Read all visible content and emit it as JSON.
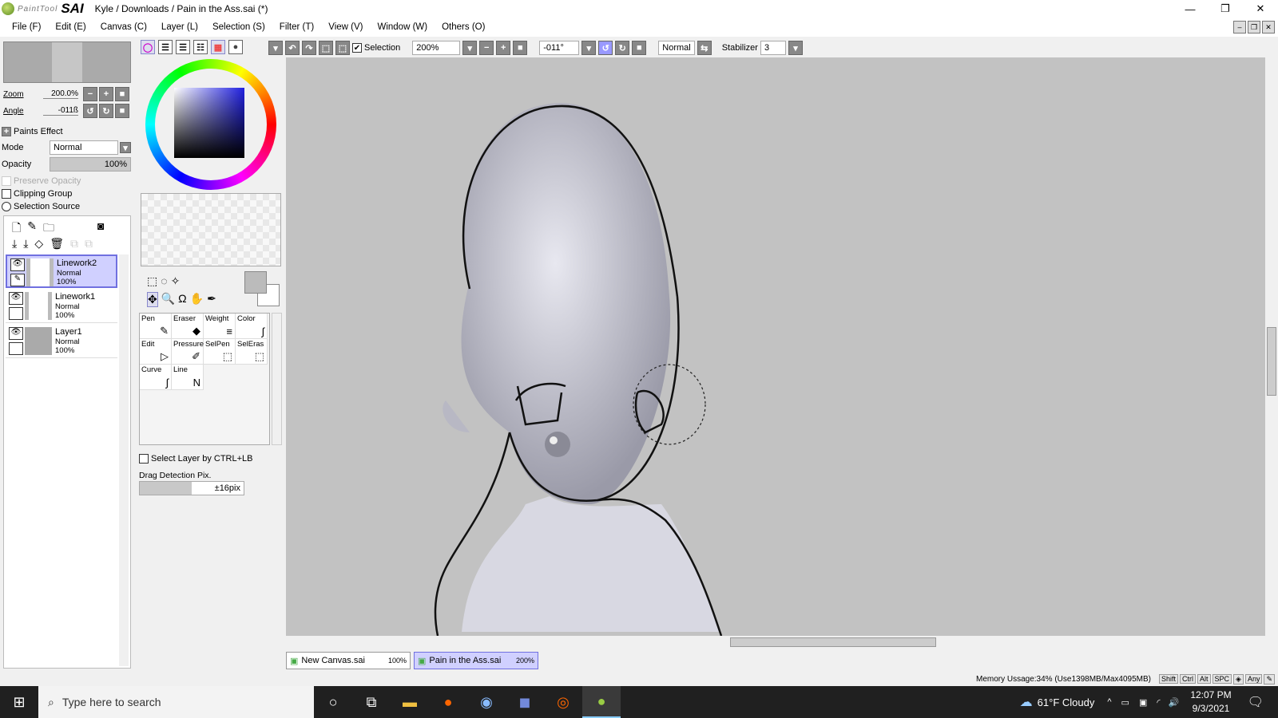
{
  "window": {
    "app_logo_small": "PaintTool",
    "app_logo": "SAI",
    "title": "Kyle / Downloads / Pain in the Ass.sai (*)",
    "minimize": "—",
    "maximize": "❐",
    "close": "✕"
  },
  "menu": [
    "File (F)",
    "Edit (E)",
    "Canvas (C)",
    "Layer (L)",
    "Selection (S)",
    "Filter (T)",
    "View (V)",
    "Window (W)",
    "Others (O)"
  ],
  "toolbar": {
    "selection_label": "Selection",
    "selection_checked": true,
    "zoom": "200%",
    "angle": "-011°",
    "blend_mode": "Normal",
    "stabilizer_label": "Stabilizer",
    "stabilizer": "3"
  },
  "navigator": {
    "zoom_label": "Zoom",
    "zoom_value": "200.0%",
    "angle_label": "Angle",
    "angle_value": "-011ß"
  },
  "layer_props": {
    "paints_effect": "Paints Effect",
    "mode_label": "Mode",
    "mode_value": "Normal",
    "opacity_label": "Opacity",
    "opacity_value": "100%",
    "preserve_opacity": "Preserve Opacity",
    "clipping_group": "Clipping Group",
    "selection_source": "Selection Source"
  },
  "layers": [
    {
      "name": "Linework2",
      "mode": "Normal",
      "opacity": "100%",
      "selected": true
    },
    {
      "name": "Linework1",
      "mode": "Normal",
      "opacity": "100%",
      "selected": false
    },
    {
      "name": "Layer1",
      "mode": "Normal",
      "opacity": "100%",
      "selected": false
    }
  ],
  "tools": [
    {
      "label": "Pen",
      "icon": "✎"
    },
    {
      "label": "Eraser",
      "icon": "◆"
    },
    {
      "label": "Weight",
      "icon": "≡"
    },
    {
      "label": "Color",
      "icon": "∫"
    },
    {
      "label": "Edit",
      "icon": "▷"
    },
    {
      "label": "Pressure",
      "icon": "✐"
    },
    {
      "label": "SelPen",
      "icon": "⬚"
    },
    {
      "label": "SelEras",
      "icon": "⬚"
    },
    {
      "label": "Curve",
      "icon": "∫"
    },
    {
      "label": "Line",
      "icon": "N"
    }
  ],
  "tool_options": {
    "select_layer": "Select Layer by CTRL+LB",
    "drag_detection_label": "Drag Detection Pix.",
    "drag_detection_value": "±16pix",
    "drag_detection_fraction": 0.5
  },
  "tabs": [
    {
      "name": "New Canvas.sai",
      "zoom": "100%",
      "active": false
    },
    {
      "name": "Pain in the Ass.sai",
      "zoom": "200%",
      "active": true
    }
  ],
  "status": {
    "memory": "Memory Ussage:34% (Use1398MB/Max4095MB)",
    "keys": [
      "Shift",
      "Ctrl",
      "Alt",
      "SPC",
      "◈",
      "Any",
      "✎"
    ]
  },
  "taskbar": {
    "search_placeholder": "Type here to search",
    "weather": "61°F  Cloudy",
    "time": "12:07 PM",
    "date": "9/3/2021"
  },
  "colors": {
    "accent": "#7070e0",
    "canvas_bg": "#c2c2c2",
    "taskbar": "#202020"
  }
}
